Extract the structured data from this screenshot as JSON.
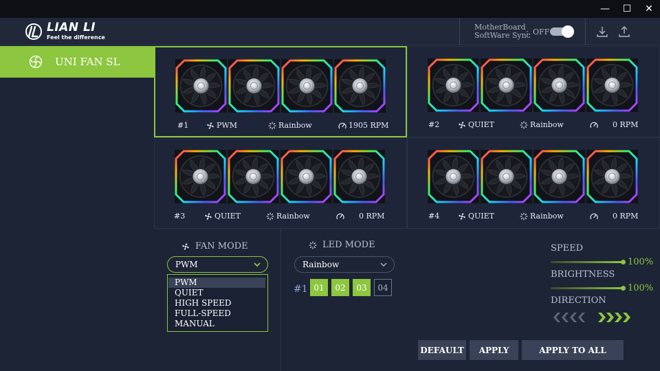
{
  "window": {
    "minimize_glyph": "—",
    "maximize_glyph": "☐",
    "close_glyph": "✕"
  },
  "brand": {
    "name": "LIAN LI",
    "tagline": "Feel the difference",
    "accent": "#8dc63f"
  },
  "sync": {
    "label_line1": "MotherBoard",
    "label_line2": "SoftWare Sync",
    "separator": ":",
    "state": "OFF"
  },
  "header_icons": [
    "download-icon",
    "upload-icon"
  ],
  "sidebar": {
    "items": [
      {
        "label": "UNI FAN SL",
        "icon": "fan-icon",
        "active": true
      }
    ]
  },
  "groups": [
    {
      "id": "#1",
      "mode": "PWM",
      "effect": "Rainbow",
      "rpm": "1905 RPM",
      "selected": true
    },
    {
      "id": "#2",
      "mode": "QUIET",
      "effect": "Rainbow",
      "rpm": "0 RPM",
      "selected": false
    },
    {
      "id": "#3",
      "mode": "QUIET",
      "effect": "Rainbow",
      "rpm": "0 RPM",
      "selected": false
    },
    {
      "id": "#4",
      "mode": "QUIET",
      "effect": "Rainbow",
      "rpm": "0 RPM",
      "selected": false
    }
  ],
  "fan_mode": {
    "title": "FAN MODE",
    "selected": "PWM",
    "options": [
      "PWM",
      "QUIET",
      "HIGH SPEED",
      "FULL-SPEED",
      "MANUAL"
    ]
  },
  "led_mode": {
    "title": "LED MODE",
    "selected": "Rainbow",
    "group_label": "#1",
    "fans": [
      {
        "label": "01",
        "on": true
      },
      {
        "label": "02",
        "on": true
      },
      {
        "label": "03",
        "on": true
      },
      {
        "label": "04",
        "on": false
      }
    ]
  },
  "speed": {
    "label": "SPEED",
    "value": "100%",
    "fraction": 1.0
  },
  "brightness": {
    "label": "BRIGHTNESS",
    "value": "100%",
    "fraction": 1.0
  },
  "direction": {
    "label": "DIRECTION",
    "selected": "right"
  },
  "buttons": {
    "default": "DEFAULT",
    "apply": "APPLY",
    "apply_all": "APPLY TO ALL"
  }
}
